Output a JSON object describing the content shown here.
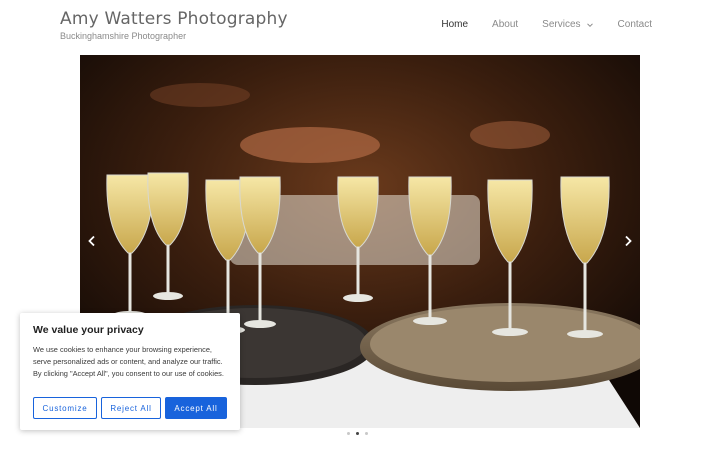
{
  "header": {
    "title": "Amy Watters Photography",
    "tagline": "Buckinghamshire Photographer"
  },
  "nav": {
    "items": [
      {
        "label": "Home",
        "active": true
      },
      {
        "label": "About"
      },
      {
        "label": "Services",
        "has_dropdown": true
      },
      {
        "label": "Contact"
      }
    ]
  },
  "slider": {
    "image": "champagne-glasses-on-trays",
    "prev_icon": "chevron-left-icon",
    "next_icon": "chevron-right-icon",
    "slide_count": 3,
    "active_index": 1
  },
  "cookie_banner": {
    "title": "We value your privacy",
    "text": "We use cookies to enhance your browsing experience, serve personalized ads or content, and analyze our traffic. By clicking \"Accept All\", you consent to our use of cookies.",
    "customize_label": "Customize",
    "reject_label": "Reject All",
    "accept_label": "Accept All",
    "accent_color": "#1863dc"
  }
}
